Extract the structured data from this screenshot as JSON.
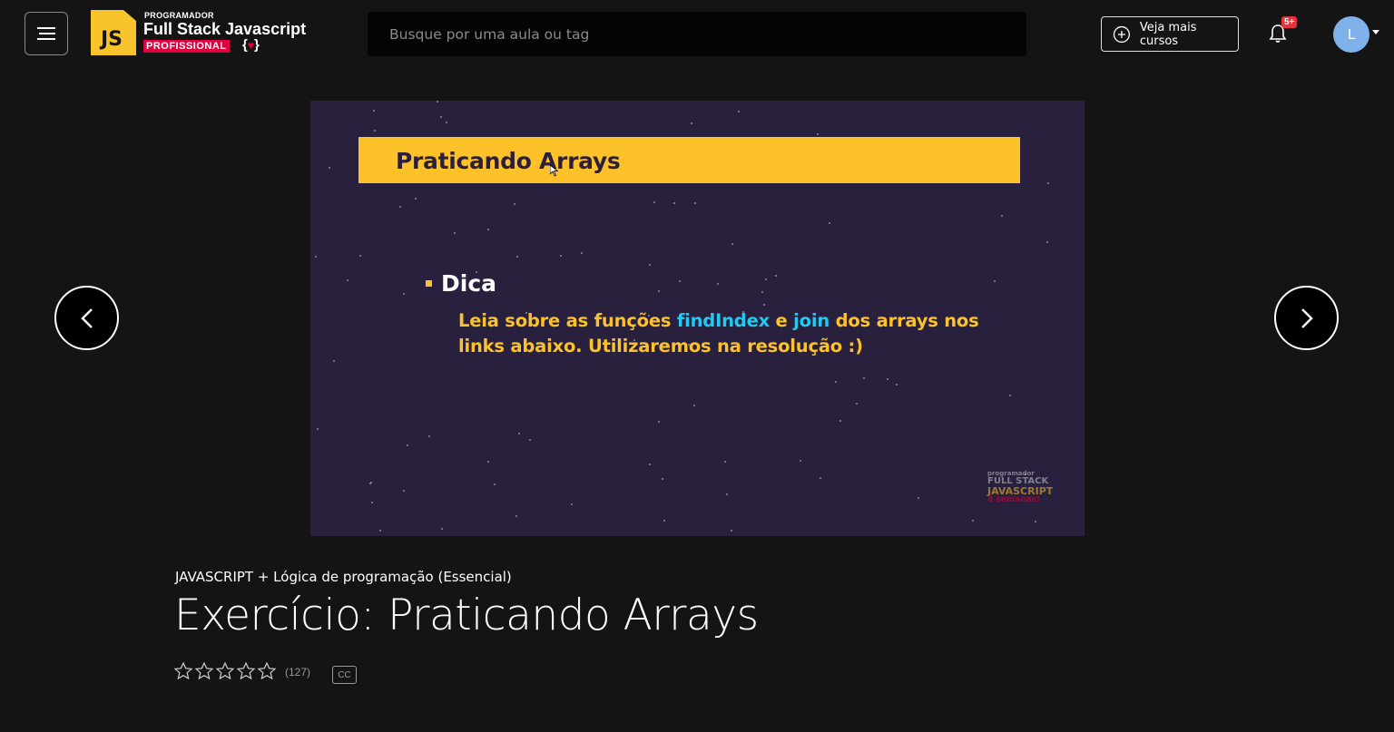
{
  "header": {
    "logo": {
      "top_text": "PROGRAMADOR",
      "main_text": "Full Stack Javascript",
      "badge_text": "PROFISSIONAL",
      "js_mark": "JS"
    },
    "menu_icon": "hamburger-icon",
    "search": {
      "placeholder": "Busque por uma aula ou tag",
      "value": ""
    },
    "more_courses_label": "Veja mais cursos",
    "notification_badge": "5+",
    "avatar_initial": "L",
    "accent_color": "#f7c52b"
  },
  "video": {
    "slide_title": "Praticando Arrays",
    "heading": "Dica",
    "body_parts": {
      "p1": "Leia sobre as funções ",
      "h1": "findIndex",
      "p2": " e ",
      "h2": "join",
      "p3": " dos arrays nos links abaixo. Utilizaremos na resolução :)"
    },
    "watermark": {
      "line1": "programador",
      "line2": "FULL STACK",
      "line3": "JAVASCRIPT",
      "line4": "8 semanas!"
    }
  },
  "lesson": {
    "course_name": "JAVASCRIPT + Lógica de programação (Essencial)",
    "title": "Exercício: Praticando Arrays",
    "rating_count": "(127)",
    "stars_filled": 0,
    "stars_total": 5,
    "cc_label": "CC"
  }
}
